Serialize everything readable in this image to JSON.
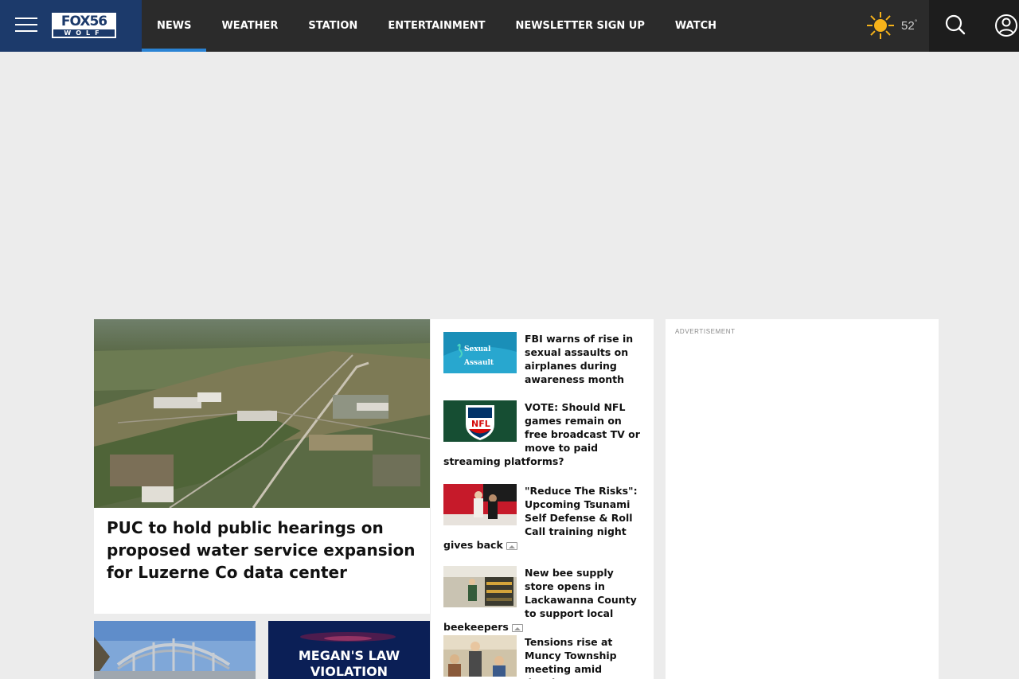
{
  "header": {
    "logo": {
      "top": "FOX56",
      "bottom": "WOLF"
    },
    "nav": [
      "NEWS",
      "WEATHER",
      "STATION",
      "ENTERTAINMENT",
      "NEWSLETTER SIGN UP",
      "WATCH"
    ],
    "active_nav": "NEWS",
    "accent_color": "#2a83d4",
    "weather": {
      "temp": "52",
      "unit": "°",
      "icon": "sun-icon"
    }
  },
  "lead": {
    "title": "PUC to hold public hearings on proposed water service expansion for Luzerne Co data center"
  },
  "thumbs": {
    "right_text_line1": "MEGAN'S LAW",
    "right_text_line2": "VIOLATION"
  },
  "stories": [
    {
      "title": "FBI warns of rise in sexual assaults on airplanes during awareness month",
      "thumb_text": "Sexual Assault",
      "gallery": false
    },
    {
      "title": "VOTE: Should NFL games remain on free broadcast TV or move to paid streaming platforms?",
      "thumb_text": "NFL",
      "gallery": false
    },
    {
      "title": "\"Reduce The Risks\": Upcoming Tsunami Self Defense & Roll Call training night gives back",
      "gallery": true
    },
    {
      "title": "New bee supply store opens in Lackawanna County to support local beekeepers",
      "gallery": true
    },
    {
      "title": "Tensions rise at Muncy Township meeting amid development",
      "gallery": false
    }
  ],
  "ad": {
    "label": "ADVERTISEMENT"
  }
}
